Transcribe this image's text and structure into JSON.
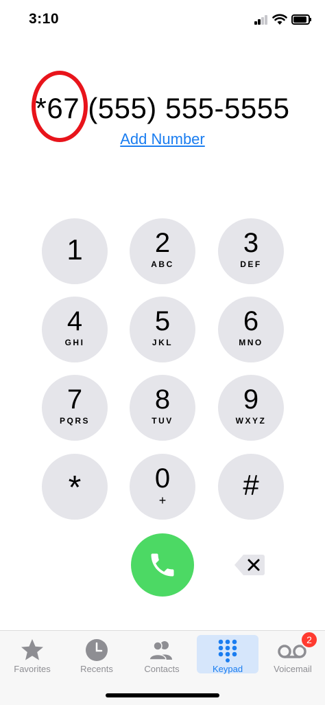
{
  "status_bar": {
    "time": "3:10",
    "signal_icon": "cellular-signal-icon",
    "wifi_icon": "wifi-icon",
    "battery_icon": "battery-icon"
  },
  "dialer": {
    "number": "*67 (555) 555-5555",
    "add_number_label": "Add Number",
    "annotation_color": "#e8141b"
  },
  "keypad": {
    "keys": [
      {
        "digit": "1",
        "letters": ""
      },
      {
        "digit": "2",
        "letters": "ABC"
      },
      {
        "digit": "3",
        "letters": "DEF"
      },
      {
        "digit": "4",
        "letters": "GHI"
      },
      {
        "digit": "5",
        "letters": "JKL"
      },
      {
        "digit": "6",
        "letters": "MNO"
      },
      {
        "digit": "7",
        "letters": "PQRS"
      },
      {
        "digit": "8",
        "letters": "TUV"
      },
      {
        "digit": "9",
        "letters": "WXYZ"
      },
      {
        "digit": "*",
        "letters": ""
      },
      {
        "digit": "0",
        "letters": "+"
      },
      {
        "digit": "#",
        "letters": ""
      }
    ],
    "call_icon": "phone-icon",
    "delete_icon": "backspace-icon",
    "call_color": "#4cd964",
    "key_color": "#e5e5ea"
  },
  "tab_bar": {
    "tabs": [
      {
        "label": "Favorites",
        "icon": "star-icon"
      },
      {
        "label": "Recents",
        "icon": "clock-icon"
      },
      {
        "label": "Contacts",
        "icon": "contacts-icon"
      },
      {
        "label": "Keypad",
        "icon": "keypad-icon",
        "active": true
      },
      {
        "label": "Voicemail",
        "icon": "voicemail-icon",
        "badge": "2"
      }
    ],
    "accent_color": "#1a7df0",
    "badge_color": "#ff3b30"
  }
}
